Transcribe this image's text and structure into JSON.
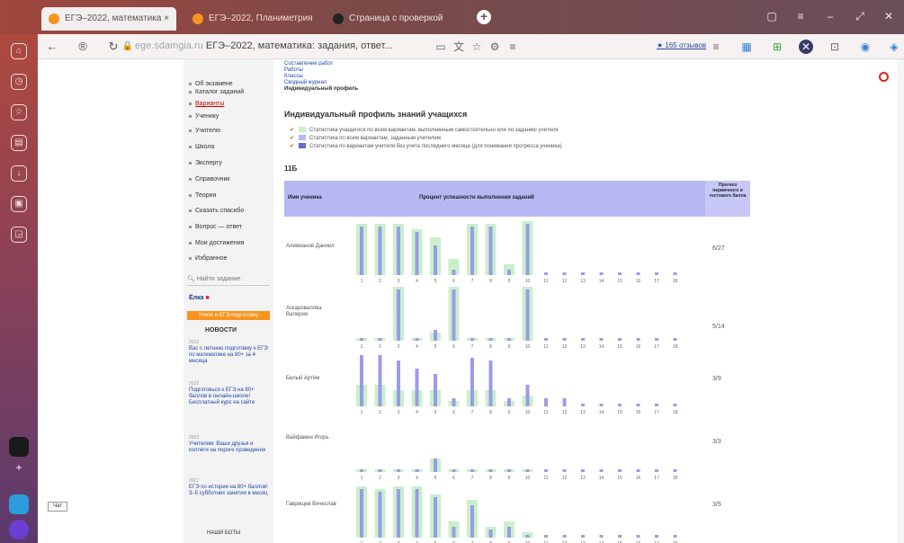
{
  "browser": {
    "tabs": [
      {
        "label": "ЕГЭ–2022, математика ×"
      },
      {
        "label": "ЕГЭ–2022, Планиметрия"
      },
      {
        "label": "Страница с проверкой"
      }
    ],
    "url_domain": "ege.sdamgia.ru",
    "url_title": "ЕГЭ–2022, математика: задания, ответ...",
    "rating": "★ 165 отзывов"
  },
  "sidebar": {
    "items": [
      {
        "label": "Об экзамене"
      },
      {
        "label": "Каталог заданий"
      },
      {
        "label": "Варианты",
        "active": true
      },
      {
        "label": "Ученику"
      },
      {
        "label": "Учителю"
      },
      {
        "label": "Школа"
      },
      {
        "label": "Эксперту"
      },
      {
        "label": "Справочник"
      },
      {
        "label": "Теория"
      },
      {
        "label": "Сказать спасибо"
      },
      {
        "label": "Вопрос — ответ"
      },
      {
        "label": "Мои достижения"
      },
      {
        "label": "Избранное"
      }
    ],
    "search_placeholder": "Найти задание",
    "elka": "Ёлка",
    "orange_bar": "Учите и ЕГЭ-подготовку",
    "news_title": "НОВОСТИ",
    "news": [
      {
        "date": "2022",
        "text": "Вас с летнюю подготовку к ЕГЭ по математике на 80+ за 4 месяца"
      },
      {
        "date": "2022",
        "text": "Подготовься к ЕГЭ на 80+ баллов в онлайн-школе! Бесплатный курс на сайте"
      },
      {
        "date": "2022",
        "text": "Учителям: Ваши друзья и коллеги на пороге проведения"
      },
      {
        "date": "2022",
        "text": "ЕГЭ по истории на 80+ баллов! 3–5 субботних занятия в месяц"
      }
    ],
    "our_bots": "НАШИ БОТЫ"
  },
  "content": {
    "breadcrumbs": [
      "Составление работ",
      "Работы",
      "Классы",
      "Сводный журнал"
    ],
    "breadcrumb_current": "Индивидуальный профиль",
    "title": "Индивидуальный профиль знаний учащихся",
    "legend": [
      {
        "text": "Статистика учащегося по всем вариантам, выполненным самостоятельно или по заданию учителя",
        "color": "#c9f0c9"
      },
      {
        "text": "Статистика по всем вариантам, заданным учителем",
        "color": "#b7b7f3"
      },
      {
        "text": "Статистика по вариантам учителя без учета последнего месяца (для понимания прогресса ученика)",
        "color": "#5f6ecf"
      }
    ],
    "class_label": "11Б",
    "headers": {
      "student": "Имя ученика",
      "percent": "Процент успешности выполнения заданий",
      "score": "Прогноз первичного и тестового балла"
    },
    "task_numbers": [
      "1",
      "2",
      "3",
      "4",
      "5",
      "6",
      "7",
      "8",
      "9",
      "10",
      "11",
      "12",
      "13",
      "14",
      "15",
      "16",
      "17",
      "18"
    ],
    "students": [
      {
        "name": "Алимханов Даниил",
        "score": "6/27",
        "green": [
          95,
          95,
          95,
          85,
          70,
          30,
          95,
          95,
          20,
          100,
          0,
          0,
          0,
          0,
          0,
          0,
          0,
          0
        ],
        "blue": [
          90,
          90,
          90,
          80,
          55,
          10,
          90,
          90,
          10,
          95,
          5,
          5,
          5,
          5,
          5,
          5,
          5,
          5
        ]
      },
      {
        "name": "Аскаровалова Валерия",
        "score": "5/14",
        "green": [
          5,
          5,
          100,
          5,
          15,
          100,
          5,
          5,
          5,
          100,
          0,
          0,
          0,
          0,
          0,
          0,
          0,
          0
        ],
        "blue": [
          5,
          5,
          95,
          5,
          20,
          95,
          5,
          5,
          5,
          95,
          5,
          5,
          5,
          5,
          5,
          5,
          5,
          5
        ]
      },
      {
        "name": "Белый Артём",
        "score": "3/9",
        "green": [
          40,
          40,
          30,
          30,
          30,
          10,
          30,
          30,
          10,
          20,
          0,
          0,
          0,
          0,
          0,
          0,
          0,
          0
        ],
        "blue": [
          95,
          95,
          85,
          70,
          60,
          15,
          90,
          85,
          15,
          40,
          15,
          15,
          5,
          5,
          5,
          5,
          5,
          5
        ]
      },
      {
        "name": "Вайфамин Игорь",
        "score": "3/3",
        "green": [
          5,
          5,
          5,
          5,
          25,
          5,
          5,
          5,
          5,
          5,
          0,
          0,
          0,
          0,
          0,
          0,
          0,
          0
        ],
        "blue": [
          5,
          5,
          5,
          5,
          25,
          5,
          5,
          5,
          5,
          5,
          5,
          5,
          5,
          5,
          5,
          5,
          5,
          5
        ]
      },
      {
        "name": "Гаврищев Вячеслав",
        "score": "3/5",
        "green": [
          95,
          90,
          95,
          95,
          80,
          30,
          70,
          20,
          30,
          10,
          0,
          0,
          0,
          0,
          0,
          0,
          0,
          0
        ],
        "blue": [
          90,
          85,
          90,
          90,
          75,
          20,
          60,
          15,
          20,
          5,
          5,
          5,
          5,
          5,
          5,
          5,
          5,
          5
        ]
      }
    ]
  },
  "feedback": "Чат",
  "colors": {
    "green": "#c9f0c9",
    "blue": "#9b9bea",
    "header": "#b7b7f3",
    "accent": "#f7941d"
  }
}
